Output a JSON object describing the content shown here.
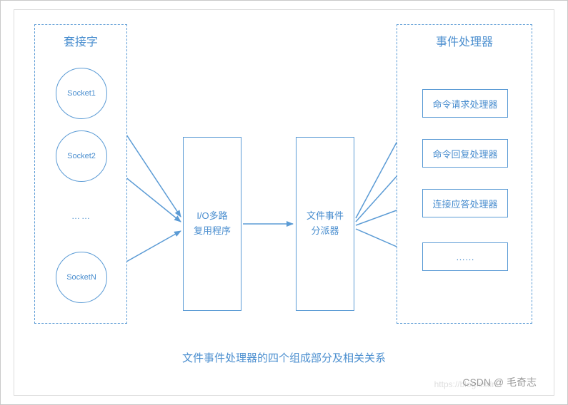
{
  "left_panel": {
    "title": "套接字",
    "sockets": [
      "Socket1",
      "Socket2",
      "SocketN"
    ],
    "ellipsis": "……"
  },
  "middle": {
    "mux": {
      "line1": "I/O多路",
      "line2": "复用程序"
    },
    "dispatcher": {
      "line1": "文件事件",
      "line2": "分派器"
    }
  },
  "right_panel": {
    "title": "事件处理器",
    "handlers": [
      "命令请求处理器",
      "命令回复处理器",
      "连接应答处理器"
    ],
    "ellipsis": "……"
  },
  "caption": "文件事件处理器的四个组成部分及相关关系",
  "watermark": "CSDN @ 毛奇志",
  "watermark_faint": "https://blog.csdn"
}
